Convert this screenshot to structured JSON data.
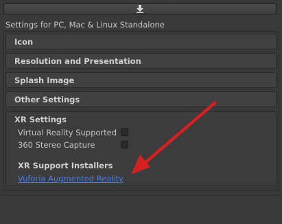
{
  "top_button": {
    "icon": "download-icon"
  },
  "settings_title": "Settings for PC, Mac & Linux Standalone",
  "sections": [
    {
      "label": "Icon"
    },
    {
      "label": "Resolution and Presentation"
    },
    {
      "label": "Splash Image"
    },
    {
      "label": "Other Settings"
    }
  ],
  "xr": {
    "title": "XR Settings",
    "options": [
      {
        "label": "Virtual Reality Supported",
        "checked": false
      },
      {
        "label": "360 Stereo Capture",
        "checked": false
      }
    ],
    "installers_title": "XR Support Installers",
    "installer_link": "Vuforia Augmented Reality"
  },
  "colors": {
    "link": "#4c7de0",
    "arrow": "#d42020"
  }
}
